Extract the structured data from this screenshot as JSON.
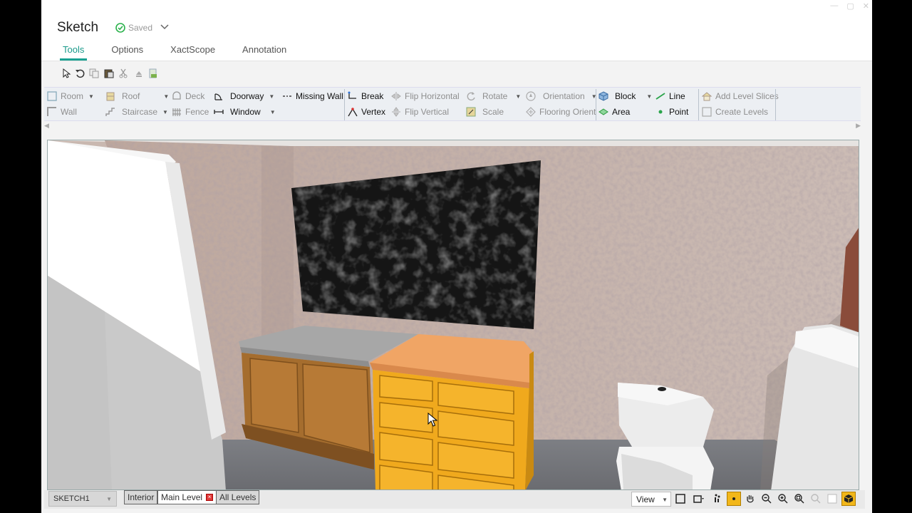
{
  "window": {
    "title": "Sketch",
    "save_status": "Saved"
  },
  "tabs": [
    {
      "label": "Tools",
      "active": true
    },
    {
      "label": "Options",
      "active": false
    },
    {
      "label": "XactScope",
      "active": false
    },
    {
      "label": "Annotation",
      "active": false
    }
  ],
  "quick_access": [
    "pointer-icon",
    "undo-icon",
    "copy-icon",
    "paste-icon",
    "cut-icon",
    "delete-icon",
    "export-icon"
  ],
  "ribbon": {
    "room": "Room",
    "wall": "Wall",
    "roof": "Roof",
    "staircase": "Staircase",
    "deck": "Deck",
    "fence": "Fence",
    "doorway": "Doorway",
    "window": "Window",
    "missing_wall": "Missing Wall",
    "break": "Break",
    "vertex": "Vertex",
    "flip_horizontal": "Flip Horizontal",
    "flip_vertical": "Flip Vertical",
    "rotate": "Rotate",
    "scale": "Scale",
    "orientation": "Orientation",
    "flooring_orient": "Flooring Orient",
    "block": "Block",
    "area": "Area",
    "line": "Line",
    "point": "Point",
    "add_level_slices": "Add Level Slices",
    "create_levels": "Create Levels"
  },
  "bottom": {
    "sketch_select": "SKETCH1",
    "tab_interior": "Interior",
    "tab_main_level": "Main Level",
    "tab_all_levels": "All Levels",
    "view_select": "View"
  },
  "colors": {
    "accent": "#1aa192",
    "highlight_tool": "#f2b71a",
    "delete_x": "#e03b3b"
  }
}
